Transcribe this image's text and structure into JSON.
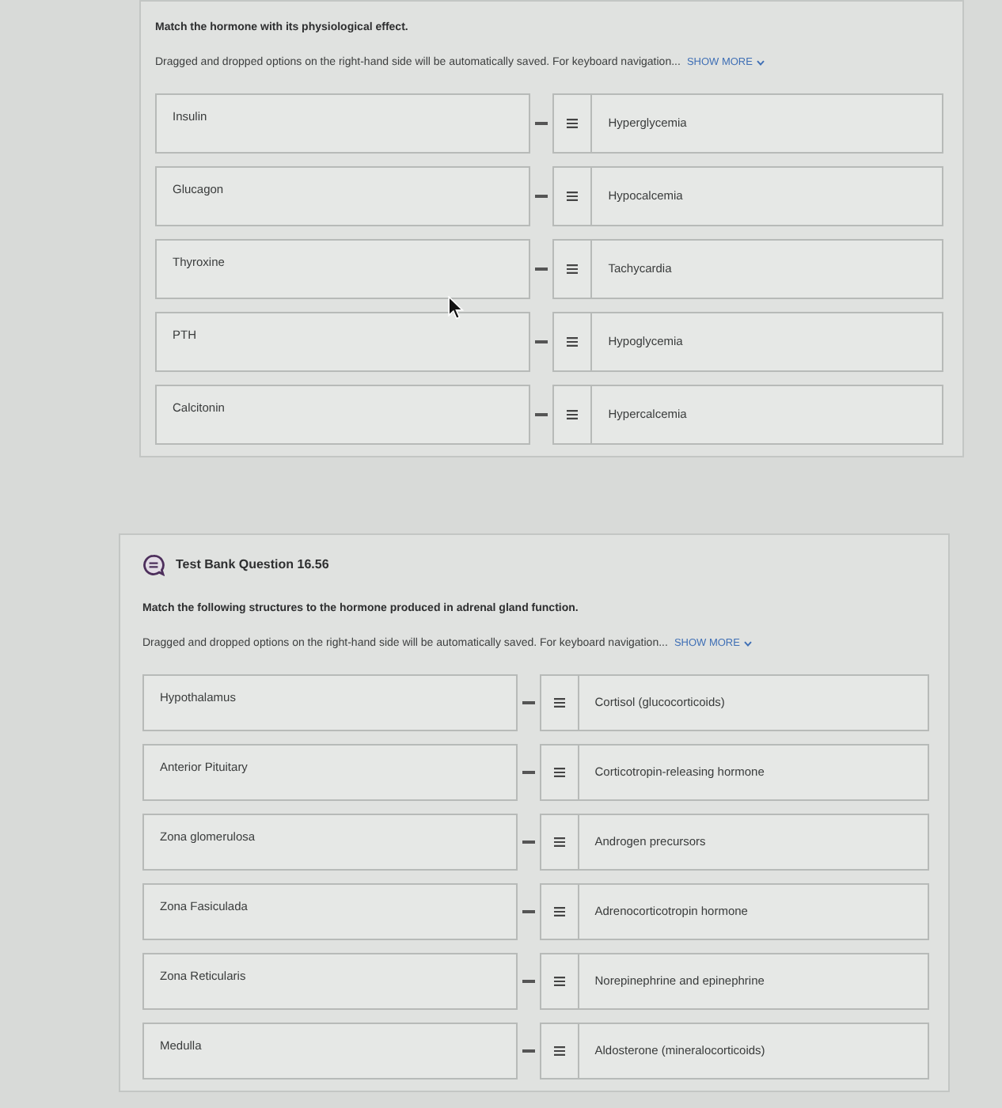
{
  "questions": [
    {
      "prompt": "Match the hormone with its physiological effect.",
      "instructions": "Dragged and dropped options on the right-hand side will be automatically saved. For keyboard navigation...",
      "show_more": "SHOW MORE",
      "pairs": [
        {
          "item": "Insulin",
          "answer": "Hyperglycemia"
        },
        {
          "item": "Glucagon",
          "answer": "Hypocalcemia"
        },
        {
          "item": "Thyroxine",
          "answer": "Tachycardia"
        },
        {
          "item": "PTH",
          "answer": "Hypoglycemia"
        },
        {
          "item": "Calcitonin",
          "answer": "Hypercalcemia"
        }
      ]
    },
    {
      "title": "Test Bank Question 16.56",
      "prompt": "Match the following structures to the hormone produced in adrenal gland function.",
      "instructions": "Dragged and dropped options on the right-hand side will be automatically saved. For keyboard navigation...",
      "show_more": "SHOW MORE",
      "pairs": [
        {
          "item": "Hypothalamus",
          "answer": "Cortisol (glucocorticoids)"
        },
        {
          "item": "Anterior Pituitary",
          "answer": "Corticotropin-releasing hormone"
        },
        {
          "item": "Zona glomerulosa",
          "answer": "Androgen precursors"
        },
        {
          "item": "Zona Fasiculada",
          "answer": "Adrenocorticotropin hormone"
        },
        {
          "item": "Zona Reticularis",
          "answer": "Norepinephrine and epinephrine"
        },
        {
          "item": "Medulla",
          "answer": "Aldosterone (mineralocorticoids)"
        }
      ]
    }
  ]
}
